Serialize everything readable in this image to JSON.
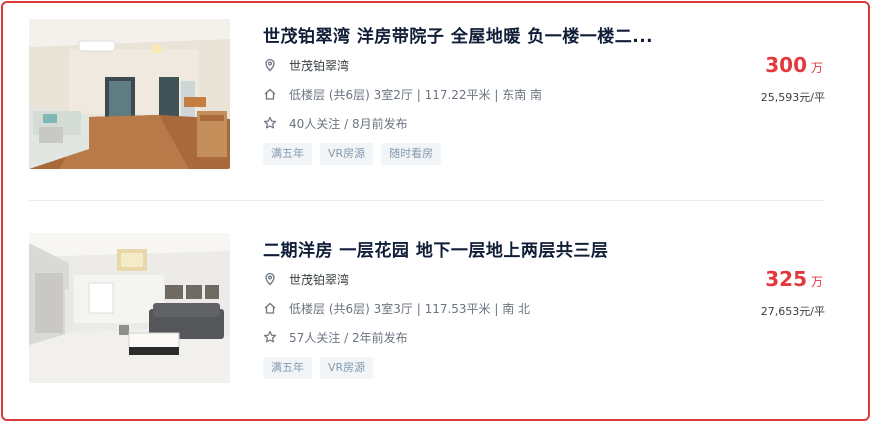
{
  "listings": [
    {
      "title": "世茂铂翠湾 洋房带院子 全屋地暖 负一楼一楼二...",
      "community": "世茂铂翠湾",
      "house_info": "低楼层 (共6层) 3室2厅 | 117.22平米 | 东南 南",
      "follow_info": "40人关注 / 8月前发布",
      "tags": [
        "满五年",
        "VR房源",
        "随时看房"
      ],
      "total_price": "300",
      "total_unit": "万",
      "unit_price": "25,593元/平"
    },
    {
      "title": "二期洋房 一层花园 地下一层地上两层共三层",
      "community": "世茂铂翠湾",
      "house_info": "低楼层 (共6层) 3室3厅 | 117.53平米 | 南 北",
      "follow_info": "57人关注 / 2年前发布",
      "tags": [
        "满五年",
        "VR房源"
      ],
      "total_price": "325",
      "total_unit": "万",
      "unit_price": "27,653元/平"
    }
  ],
  "icons": {
    "location": "location-pin-icon",
    "house": "house-icon",
    "follow": "star-icon"
  },
  "colors": {
    "frame_border": "#d93a3a",
    "price": "#e4393c",
    "title": "#101d37",
    "tag_bg": "#f2f5f7",
    "tag_text": "#849aae"
  }
}
